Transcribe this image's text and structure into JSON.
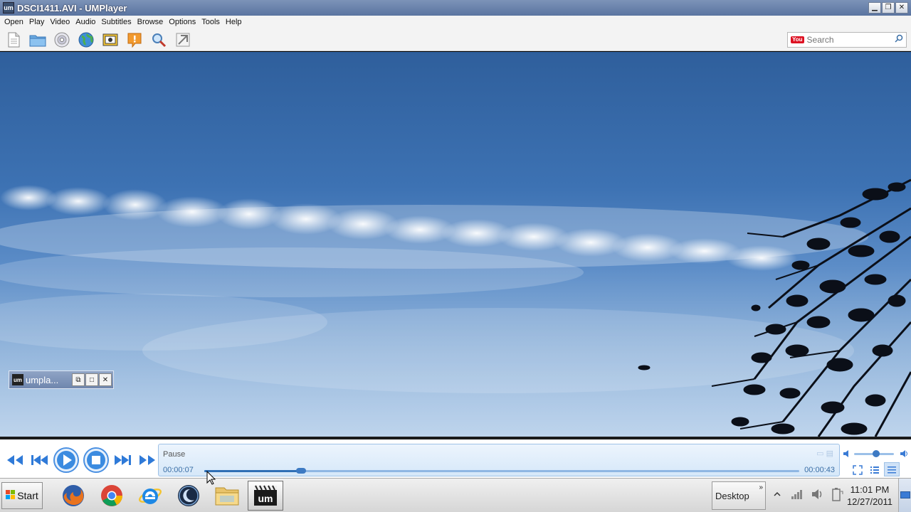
{
  "window": {
    "title": "DSCI1411.AVI - UMPlayer",
    "app_icon_text": "um",
    "buttons": [
      "minimize",
      "maximize",
      "close"
    ]
  },
  "menu": {
    "items": [
      "Open",
      "Play",
      "Video",
      "Audio",
      "Subtitles",
      "Browse",
      "Options",
      "Tools",
      "Help"
    ]
  },
  "toolbar": {
    "icons": [
      "open-file-icon",
      "open-folder-icon",
      "disc-icon",
      "globe-icon",
      "screenshot-icon",
      "info-icon",
      "search-icon",
      "settings-icon"
    ],
    "search": {
      "placeholder": "Search",
      "provider_badge": "You"
    }
  },
  "minimized_window": {
    "label": "umpla...",
    "icon_text": "um"
  },
  "controls": {
    "status": "Pause",
    "current_time": "00:00:07",
    "total_time": "00:00:43",
    "progress": 0.163,
    "volume": 0.55
  },
  "taskbar": {
    "start_label": "Start",
    "apps": [
      "firefox-icon",
      "chrome-icon",
      "internet-explorer-icon",
      "moon-app-icon",
      "file-explorer-icon",
      "umplayer-icon"
    ],
    "desktop_label": "Desktop",
    "chevron": "»",
    "clock_time": "11:01 PM",
    "clock_date": "12/27/2011"
  },
  "colors": {
    "titlebar": "#5a74a0",
    "sky_top": "#2f5f9c",
    "sky_bottom": "#9bbde2",
    "accent": "#3d7ac3"
  }
}
